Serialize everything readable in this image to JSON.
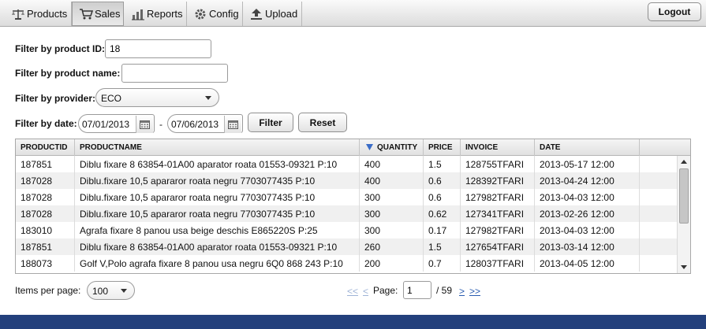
{
  "nav": {
    "tabs": [
      {
        "label": "Products",
        "icon": "scale-icon"
      },
      {
        "label": "Sales",
        "icon": "cart-icon"
      },
      {
        "label": "Reports",
        "icon": "bar-chart-icon"
      },
      {
        "label": "Config",
        "icon": "gear-icon"
      },
      {
        "label": "Upload",
        "icon": "upload-icon"
      }
    ],
    "active_tab": "Sales",
    "logout_label": "Logout"
  },
  "filters": {
    "product_id": {
      "label": "Filter by product ID:",
      "value": "18"
    },
    "product_name": {
      "label": "Filter by product name:",
      "value": ""
    },
    "provider": {
      "label": "Filter by provider:",
      "value": "ECO"
    },
    "date": {
      "label": "Filter by date:",
      "from": "07/01/2013",
      "separator": "-",
      "to": "07/06/2013"
    },
    "filter_button": "Filter",
    "reset_button": "Reset"
  },
  "table": {
    "columns": [
      "PRODUCTID",
      "PRODUCTNAME",
      "QUANTITY",
      "PRICE",
      "INVOICE",
      "DATE"
    ],
    "sorted_column": "QUANTITY",
    "sort_direction": "descending",
    "rows": [
      [
        "187851",
        "Diblu fixare 8 63854-01A00 aparator roata 01553-09321 P:10",
        "400",
        "1.5",
        "128755TFARI",
        "2013-05-17 12:00"
      ],
      [
        "187028",
        "Diblu.fixare 10,5 apararor roata negru 7703077435 P:10",
        "400",
        "0.6",
        "128392TFARI",
        "2013-04-24 12:00"
      ],
      [
        "187028",
        "Diblu.fixare 10,5 apararor roata negru 7703077435 P:10",
        "300",
        "0.6",
        "127982TFARI",
        "2013-04-03 12:00"
      ],
      [
        "187028",
        "Diblu.fixare 10,5 apararor roata negru 7703077435 P:10",
        "300",
        "0.62",
        "127341TFARI",
        "2013-02-26 12:00"
      ],
      [
        "183010",
        "Agrafa fixare 8 panou usa beige deschis E865220S P:25",
        "300",
        "0.17",
        "127982TFARI",
        "2013-04-03 12:00"
      ],
      [
        "187851",
        "Diblu fixare 8 63854-01A00 aparator roata 01553-09321 P:10",
        "260",
        "1.5",
        "127654TFARI",
        "2013-03-14 12:00"
      ],
      [
        "188073",
        "Golf V,Polo agrafa fixare 8 panou usa negru 6Q0 868 243 P:10",
        "200",
        "0.7",
        "128037TFARI",
        "2013-04-05 12:00"
      ]
    ]
  },
  "pagination": {
    "items_per_page_label": "Items per page:",
    "items_per_page": "100",
    "first": "<<",
    "prev": "<",
    "page_label": "Page:",
    "page": "1",
    "total_text": "/ 59",
    "next": ">",
    "last": ">>"
  },
  "colors": {
    "bottom_bar": "#23407c",
    "link": "#2a5db0",
    "sort_arrow": "#3a6cc7"
  }
}
